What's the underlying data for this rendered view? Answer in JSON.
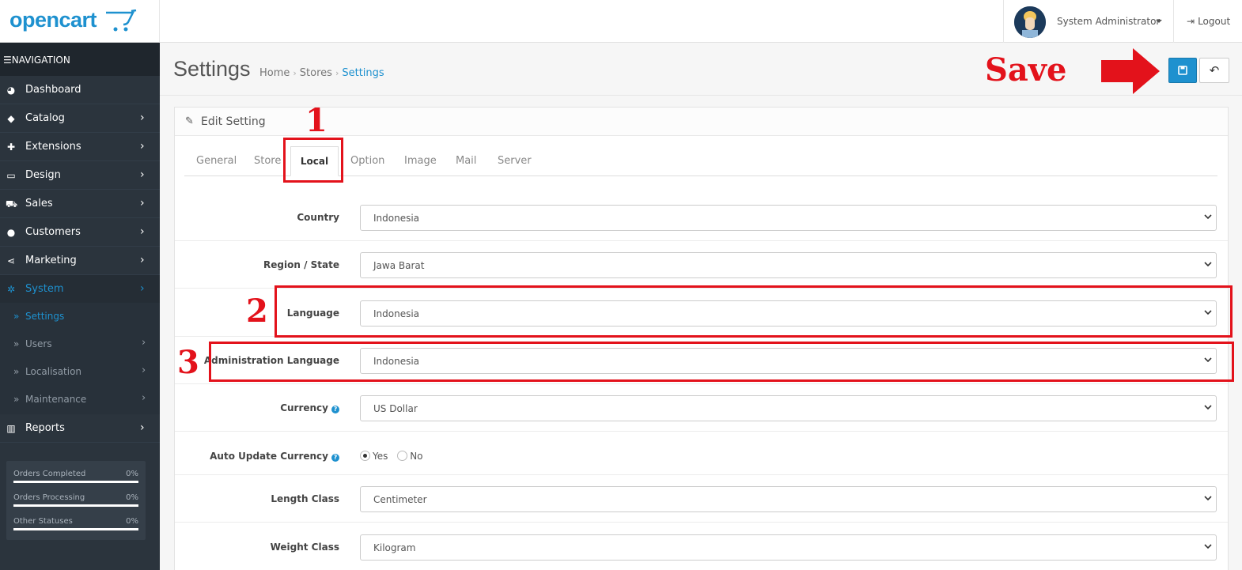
{
  "header": {
    "logo_text": "opencart",
    "user_name": "System Administrator",
    "logout_label": "Logout"
  },
  "sidebar": {
    "nav_title": "NAVIGATION",
    "items": [
      {
        "label": "Dashboard",
        "icon": "dashboard-icon"
      },
      {
        "label": "Catalog",
        "icon": "tags-icon"
      },
      {
        "label": "Extensions",
        "icon": "puzzle-icon"
      },
      {
        "label": "Design",
        "icon": "monitor-icon"
      },
      {
        "label": "Sales",
        "icon": "cart-icon"
      },
      {
        "label": "Customers",
        "icon": "user-icon"
      },
      {
        "label": "Marketing",
        "icon": "share-icon"
      },
      {
        "label": "System",
        "icon": "gear-icon"
      },
      {
        "label": "Reports",
        "icon": "bar-chart-icon"
      }
    ],
    "system_sub": [
      {
        "label": "Settings"
      },
      {
        "label": "Users"
      },
      {
        "label": "Localisation"
      },
      {
        "label": "Maintenance"
      }
    ],
    "stats": [
      {
        "label": "Orders Completed",
        "value": "0%"
      },
      {
        "label": "Orders Processing",
        "value": "0%"
      },
      {
        "label": "Other Statuses",
        "value": "0%"
      }
    ]
  },
  "page": {
    "title": "Settings",
    "breadcrumb": [
      "Home",
      "Stores",
      "Settings"
    ]
  },
  "panel": {
    "title": "Edit Setting",
    "tabs": [
      "General",
      "Store",
      "Local",
      "Option",
      "Image",
      "Mail",
      "Server"
    ],
    "active_tab": "Local"
  },
  "form": {
    "country": {
      "label": "Country",
      "value": "Indonesia"
    },
    "region": {
      "label": "Region / State",
      "value": "Jawa Barat"
    },
    "language": {
      "label": "Language",
      "value": "Indonesia"
    },
    "admin_language": {
      "label": "Administration Language",
      "value": "Indonesia"
    },
    "currency": {
      "label": "Currency",
      "value": "US Dollar"
    },
    "auto_update": {
      "label": "Auto Update Currency",
      "yes": "Yes",
      "no": "No",
      "selected": "Yes"
    },
    "length_class": {
      "label": "Length Class",
      "value": "Centimeter"
    },
    "weight_class": {
      "label": "Weight Class",
      "value": "Kilogram"
    }
  },
  "annotations": {
    "save_text": "Save",
    "n1": "1",
    "n2": "2",
    "n3": "3",
    "color": "#e3121b"
  }
}
